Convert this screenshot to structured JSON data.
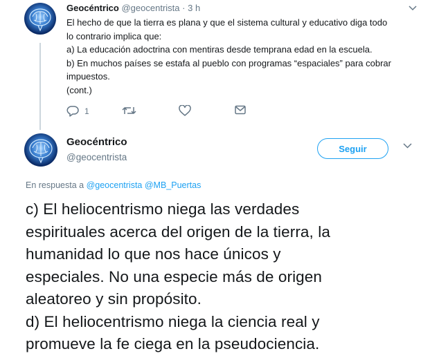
{
  "thread_tweet": {
    "display_name": "Geocéntrico",
    "handle": "@geocentrista",
    "separator": "·",
    "time": "3 h",
    "lines": [
      "El hecho de que la tierra es plana y que el sistema cultural y educativo diga todo",
      "lo contrario implica que:",
      "a) La educación adoctrina con mentiras desde temprana edad en la escuela.",
      "b) En muchos países se estafa al pueblo con programas “espaciales” para cobrar",
      "impuestos.",
      "(cont.)"
    ],
    "actions": {
      "reply_count": "1",
      "retweet_count": "",
      "like_count": ""
    },
    "icons": {
      "reply": "reply-icon",
      "retweet": "retweet-icon",
      "like": "heart-icon",
      "dm": "envelope-icon",
      "more": "chevron-down-icon"
    }
  },
  "main_tweet": {
    "display_name": "Geocéntrico",
    "handle": "@geocentrista",
    "follow_label": "Seguir",
    "reply_prefix": "En respuesta a",
    "reply_mentions": [
      "@geocentrista",
      "@MB_Puertas"
    ],
    "lines": [
      "c) El heliocentrismo niega las verdades",
      "espirituales acerca del origen de la tierra, la",
      "humanidad lo que nos hace únicos y",
      "especiales. No una especie más de origen",
      "aleatoreo y sin propósito.",
      "d) El heliocentrismo niega la ciencia real y",
      "promueve la fe ciega en la pseudociencia."
    ]
  },
  "colors": {
    "accent": "#1da1f2",
    "text": "#14171a",
    "muted": "#657786",
    "thread_line": "#ccd6dd"
  }
}
